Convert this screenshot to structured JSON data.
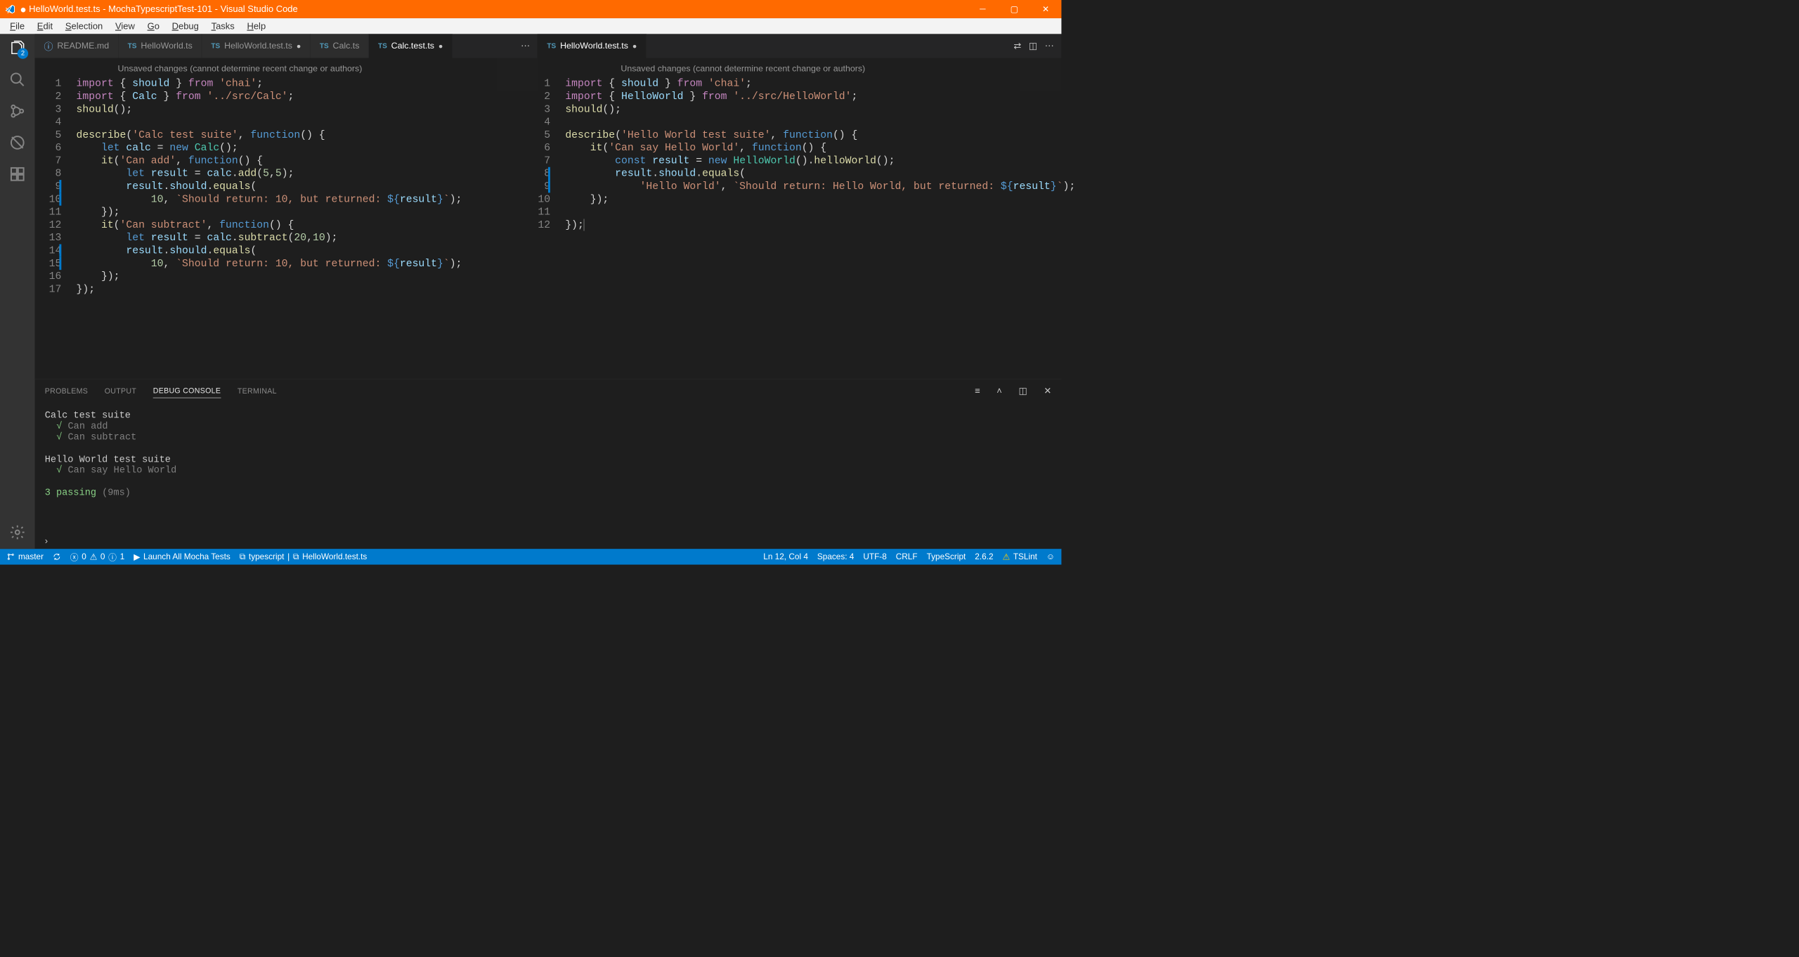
{
  "titlebar": {
    "modified_indicator": "●",
    "title": "HelloWorld.test.ts - MochaTypescriptTest-101 - Visual Studio Code"
  },
  "menu": [
    "File",
    "Edit",
    "Selection",
    "View",
    "Go",
    "Debug",
    "Tasks",
    "Help"
  ],
  "activitybar": {
    "explorer_badge": "2"
  },
  "editors": {
    "group1": {
      "tabs": [
        {
          "icon": "info",
          "label": "README.md",
          "modified": false
        },
        {
          "icon": "ts",
          "label": "HelloWorld.ts",
          "modified": false
        },
        {
          "icon": "ts",
          "label": "HelloWorld.test.ts",
          "modified": true
        },
        {
          "icon": "ts",
          "label": "Calc.ts",
          "modified": false
        },
        {
          "icon": "ts",
          "label": "Calc.test.ts",
          "modified": true,
          "active": true
        }
      ],
      "unsaved_msg": "Unsaved changes (cannot determine recent change or authors)",
      "lines": 17
    },
    "group2": {
      "tabs": [
        {
          "icon": "ts",
          "label": "HelloWorld.test.ts",
          "modified": true,
          "active": true
        }
      ],
      "unsaved_msg": "Unsaved changes (cannot determine recent change or authors)",
      "lines": 12
    }
  },
  "code_left": {
    "l1": {
      "import": "import",
      "b1": " { ",
      "should": "should",
      "b2": " } ",
      "from": "from",
      "sp": " ",
      "str": "'chai'",
      "end": ";"
    },
    "l2": {
      "import": "import",
      "b1": " { ",
      "calc": "Calc",
      "b2": " } ",
      "from": "from",
      "sp": " ",
      "str": "'../src/Calc'",
      "end": ";"
    },
    "l3": {
      "should": "should",
      "end": "();"
    },
    "l5": {
      "desc": "describe",
      "p": "(",
      "str": "'Calc test suite'",
      "c": ", ",
      "fn": "function",
      "end": "() {"
    },
    "l6": {
      "let": "let",
      "sp": " ",
      "v": "calc",
      "eq": " = ",
      "new": "new",
      "sp2": " ",
      "cls": "Calc",
      "end": "();"
    },
    "l7": {
      "it": "it",
      "p": "(",
      "str": "'Can add'",
      "c": ", ",
      "fn": "function",
      "end": "() {"
    },
    "l8": {
      "let": "let",
      "sp": " ",
      "v": "result",
      "eq": " = ",
      "obj": "calc",
      "dot": ".",
      "m": "add",
      "args": "(",
      "n1": "5",
      "cm": ",",
      "n2": "5",
      "end": ");"
    },
    "l9": {
      "obj": "result",
      "d1": ".",
      "p1": "should",
      "d2": ".",
      "m": "equals",
      "end": "("
    },
    "l10": {
      "n": "10",
      "c": ", ",
      "bt": "`Should return: 10, but returned: ",
      "dl": "${",
      "v": "result",
      "dr": "}",
      "bt2": "`",
      "end": ");"
    },
    "l11": {
      "end": "});"
    },
    "l12": {
      "it": "it",
      "p": "(",
      "str": "'Can subtract'",
      "c": ", ",
      "fn": "function",
      "end": "() {"
    },
    "l13": {
      "let": "let",
      "sp": " ",
      "v": "result",
      "eq": " = ",
      "obj": "calc",
      "dot": ".",
      "m": "subtract",
      "args": "(",
      "n1": "20",
      "cm": ",",
      "n2": "10",
      "end": ");"
    },
    "l14": {
      "obj": "result",
      "d1": ".",
      "p1": "should",
      "d2": ".",
      "m": "equals",
      "end": "("
    },
    "l15": {
      "n": "10",
      "c": ", ",
      "bt": "`Should return: 10, but returned: ",
      "dl": "${",
      "v": "result",
      "dr": "}",
      "bt2": "`",
      "end": ");"
    },
    "l16": {
      "end": "});"
    },
    "l17": {
      "end": "});"
    }
  },
  "code_right": {
    "l1": {
      "import": "import",
      "b1": " { ",
      "should": "should",
      "b2": " } ",
      "from": "from",
      "sp": " ",
      "str": "'chai'",
      "end": ";"
    },
    "l2": {
      "import": "import",
      "b1": " { ",
      "hw": "HelloWorld",
      "b2": " } ",
      "from": "from",
      "sp": " ",
      "str": "'../src/HelloWorld'",
      "end": ";"
    },
    "l3": {
      "should": "should",
      "end": "();"
    },
    "l5": {
      "desc": "describe",
      "p": "(",
      "str": "'Hello World test suite'",
      "c": ", ",
      "fn": "function",
      "end": "() {"
    },
    "l6": {
      "it": "it",
      "p": "(",
      "str": "'Can say Hello World'",
      "c": ", ",
      "fn": "function",
      "end": "() {"
    },
    "l7": {
      "const": "const",
      "sp": " ",
      "v": "result",
      "eq": " = ",
      "new": "new",
      "sp2": " ",
      "cls": "HelloWorld",
      "c1": "().",
      "m": "helloWorld",
      "end": "();"
    },
    "l8": {
      "obj": "result",
      "d1": ".",
      "p1": "should",
      "d2": ".",
      "m": "equals",
      "end": "("
    },
    "l9": {
      "str": "'Hello World'",
      "c": ", ",
      "bt": "`Should return: Hello World, but returned: ",
      "dl": "${",
      "v": "result",
      "dr": "}",
      "bt2": "`",
      "end": ");"
    },
    "l10": {
      "end": "});"
    },
    "l12": {
      "end": "});"
    }
  },
  "panel": {
    "tabs": [
      "PROBLEMS",
      "OUTPUT",
      "DEBUG CONSOLE",
      "TERMINAL"
    ],
    "active_tab": "DEBUG CONSOLE",
    "output": {
      "suite1": "Calc test suite",
      "test1a": "Can add",
      "test1b": "Can subtract",
      "suite2": "Hello World test suite",
      "test2a": "Can say Hello World",
      "summary_pass": "3 passing",
      "summary_time": " (9ms)",
      "check": "√"
    }
  },
  "statusbar": {
    "branch": "master",
    "errors": "0",
    "warnings": "0",
    "info": "1",
    "launch": "Launch All Mocha Tests",
    "lang_task": "typescript",
    "file": "HelloWorld.test.ts",
    "cursor": "Ln 12, Col 4",
    "spaces": "Spaces: 4",
    "encoding": "UTF-8",
    "eol": "CRLF",
    "lang": "TypeScript",
    "version": "2.6.2",
    "tslint": "TSLint"
  }
}
